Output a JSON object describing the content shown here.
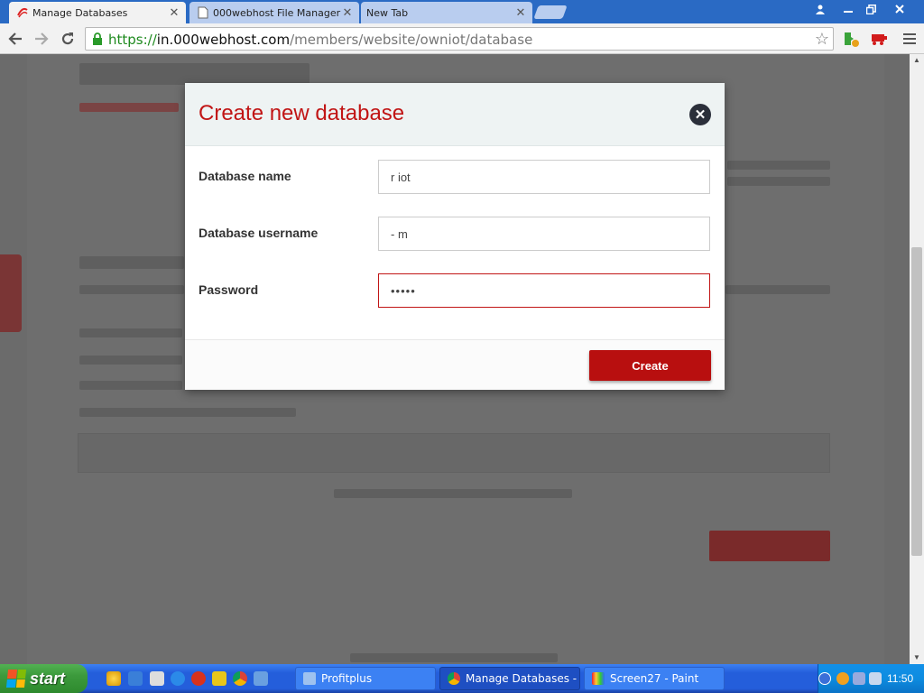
{
  "browser": {
    "tabs": [
      {
        "title": "Manage Databases",
        "icon": "webhost-favicon",
        "active": true
      },
      {
        "title": "000webhost File Manager",
        "icon": "page-favicon",
        "active": false
      },
      {
        "title": "New Tab",
        "icon": "",
        "active": false
      }
    ],
    "tab_close_glyph": "✕",
    "url": {
      "scheme": "https://",
      "host": "in.000webhost.com",
      "path": "/members/website/owniot/database"
    }
  },
  "modal": {
    "title": "Create new database",
    "close_icon": "close-icon",
    "fields": [
      {
        "label": "Database name",
        "value": "r iot",
        "type": "text",
        "error": false
      },
      {
        "label": "Database username",
        "value": "- m",
        "type": "text",
        "error": false
      },
      {
        "label": "Password",
        "value": "•••••",
        "type": "password",
        "error": true
      }
    ],
    "create_label": "Create",
    "accent_color": "#c11515"
  },
  "taskbar": {
    "start_label": "start",
    "tasks": [
      {
        "label": "Profitplus",
        "icon": "app-icon",
        "pressed": false
      },
      {
        "label": "Manage Databases - ...",
        "icon": "chrome-icon",
        "pressed": true
      },
      {
        "label": "Screen27 - Paint",
        "icon": "paint-icon",
        "pressed": false
      }
    ],
    "clock": "11:50"
  }
}
